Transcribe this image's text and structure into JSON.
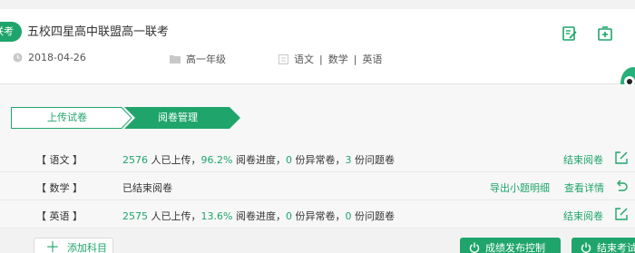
{
  "exam": {
    "tag": "联考",
    "title": "五校四星高中联盟高一联考",
    "date": "2018-04-26",
    "grade": "高一年级",
    "subjects": [
      "语文",
      "数学",
      "英语"
    ]
  },
  "steps": {
    "upload": "上传试卷",
    "review": "阅卷管理"
  },
  "rows": [
    {
      "subject": "【 语文 】",
      "uploaded": "2576",
      "uploaded_suffix": " 人已上传，",
      "progress": "96.2%",
      "progress_suffix": " 阅卷进度，",
      "abnormal": "0",
      "abnormal_suffix": " 份异常卷，",
      "problem": "3",
      "problem_suffix": " 份问题卷",
      "action": "结束阅卷"
    },
    {
      "subject": "【 数学 】",
      "status": "已结束阅卷",
      "export": "导出小题明细",
      "detail": "查看详情"
    },
    {
      "subject": "【 英语 】",
      "uploaded": "2575",
      "uploaded_suffix": " 人已上传，",
      "progress": "13.6%",
      "progress_suffix": " 阅卷进度，",
      "abnormal": "0",
      "abnormal_suffix": " 份异常卷，",
      "problem": "0",
      "problem_suffix": " 份问题卷",
      "action": "结束阅卷"
    }
  ],
  "buttons": {
    "add_subject": "添加科目",
    "publish_control": "成绩发布控制",
    "end_exam": "结束考试"
  },
  "colors": {
    "accent": "#1fa56b",
    "step_active_bg": "#1fa56b"
  },
  "icons": {
    "edit": "edit-icon",
    "add": "add-icon",
    "clock": "clock-icon",
    "folder": "folder-icon",
    "book": "book-icon",
    "share": "share-icon",
    "undo": "undo-icon",
    "power": "power-icon",
    "plus": "plus-icon"
  }
}
